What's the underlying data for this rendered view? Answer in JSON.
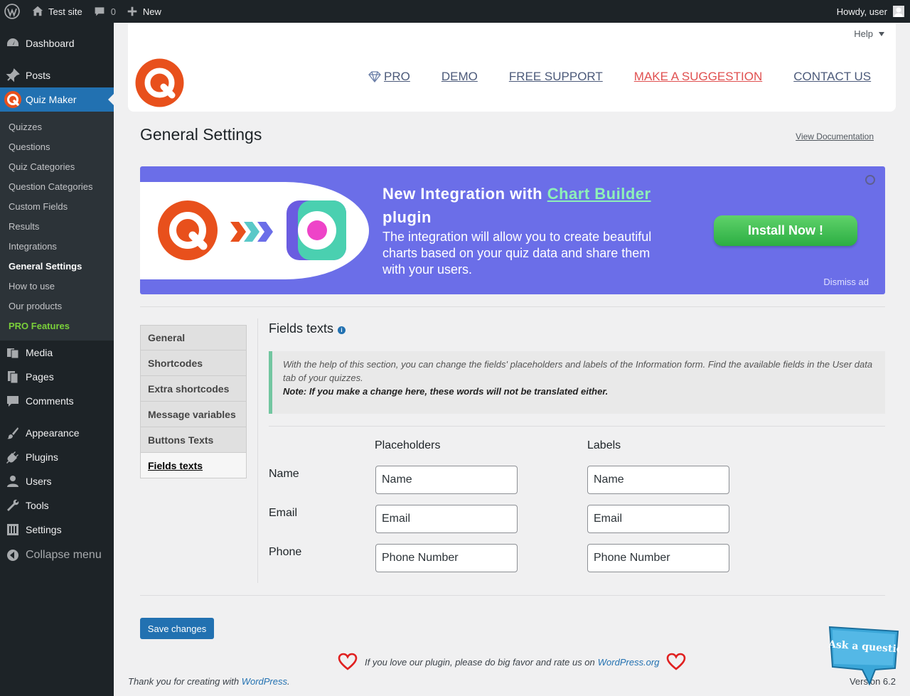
{
  "adminbar": {
    "site_name": "Test site",
    "comments_count": "0",
    "new_label": "New",
    "howdy": "Howdy, user"
  },
  "sidebar": {
    "items_top": [
      {
        "label": "Dashboard",
        "icon": "dashboard-icon"
      },
      {
        "label": "Posts",
        "icon": "pin-icon"
      }
    ],
    "current": {
      "label": "Quiz Maker",
      "icon": "quiz-maker-logo-icon"
    },
    "submenu": [
      "Quizzes",
      "Questions",
      "Quiz Categories",
      "Question Categories",
      "Custom Fields",
      "Results",
      "Integrations",
      "General Settings",
      "How to use",
      "Our products",
      "PRO Features"
    ],
    "items_bottom": [
      {
        "label": "Media",
        "icon": "media-icon"
      },
      {
        "label": "Pages",
        "icon": "pages-icon"
      },
      {
        "label": "Comments",
        "icon": "comment-icon"
      },
      {
        "label": "Appearance",
        "icon": "brush-icon"
      },
      {
        "label": "Plugins",
        "icon": "plug-icon"
      },
      {
        "label": "Users",
        "icon": "user-icon"
      },
      {
        "label": "Tools",
        "icon": "wrench-icon"
      },
      {
        "label": "Settings",
        "icon": "settings-sliders-icon"
      }
    ],
    "collapse": "Collapse menu"
  },
  "header": {
    "help": "Help",
    "nav": [
      "PRO",
      "DEMO",
      "FREE SUPPORT",
      "MAKE A SUGGESTION",
      "CONTACT US"
    ]
  },
  "page": {
    "title": "General Settings",
    "view_doc": "View Documentation"
  },
  "banner": {
    "title_prefix": "New Integration with ",
    "title_link": "Chart Builder",
    "title_suffix": " plugin",
    "description": "The integration will allow you to create beautiful charts based on your quiz data and share them with your users.",
    "install": "Install Now !",
    "dismiss": "Dismiss ad"
  },
  "tabs": [
    "General",
    "Shortcodes",
    "Extra shortcodes",
    "Message variables",
    "Buttons Texts",
    "Fields texts"
  ],
  "active_tab": "Fields texts",
  "content": {
    "section_title": "Fields texts",
    "notice": "With the help of this section, you can change the fields' placeholders and labels of the Information form. Find the available fields in the User data tab of your quizzes.",
    "notice_bold": "Note: If you make a change here, these words will not be translated either.",
    "col_placeholders": "Placeholders",
    "col_labels": "Labels",
    "rows": [
      {
        "label": "Name",
        "placeholder": "Name",
        "field_label": "Name"
      },
      {
        "label": "Email",
        "placeholder": "Email",
        "field_label": "Email"
      },
      {
        "label": "Phone",
        "placeholder": "Phone Number",
        "field_label": "Phone Number"
      }
    ]
  },
  "footer": {
    "save": "Save changes",
    "rate_text": "If you love our plugin, please do big favor and rate us on",
    "rate_link": "WordPress.org",
    "thanks_text": "Thank you for creating with",
    "thanks_link": "WordPress",
    "version": "Version 6.2",
    "ask": "Ask a question"
  },
  "colors": {
    "accent": "#2271b1",
    "banner": "#6b6ee8",
    "install": "#2cae43",
    "brand": "#e8501c"
  }
}
